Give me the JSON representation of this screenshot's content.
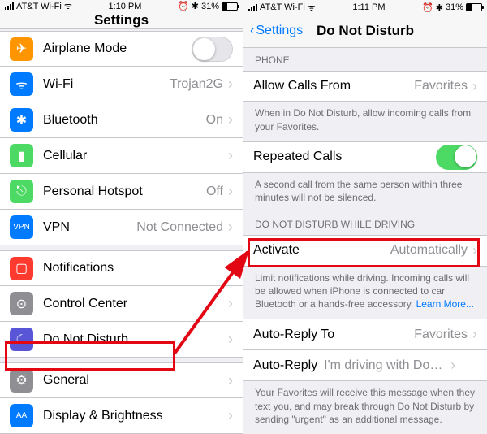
{
  "left": {
    "status": {
      "carrier": "AT&T Wi-Fi",
      "time": "1:10 PM",
      "battery": "31%",
      "alarm": "⏰",
      "bt": "✱"
    },
    "title": "Settings",
    "rows": [
      {
        "icon": "✈",
        "color": "#ff9500",
        "label": "Airplane Mode",
        "toggle": "off"
      },
      {
        "icon": "ᯤ",
        "color": "#007aff",
        "label": "Wi-Fi",
        "value": "Trojan2G"
      },
      {
        "icon": "✱",
        "color": "#007aff",
        "label": "Bluetooth",
        "value": "On"
      },
      {
        "icon": "▮",
        "color": "#4cd964",
        "label": "Cellular",
        "value": ""
      },
      {
        "icon": "⎋",
        "color": "#4cd964",
        "label": "Personal Hotspot",
        "value": "Off"
      },
      {
        "icon": "VPN",
        "color": "#007aff",
        "label": "VPN",
        "value": "Not Connected",
        "small": true
      }
    ],
    "rows2": [
      {
        "icon": "▢",
        "color": "#ff3b30",
        "label": "Notifications"
      },
      {
        "icon": "⊙",
        "color": "#8e8e93",
        "label": "Control Center"
      },
      {
        "icon": "☾",
        "color": "#5856d6",
        "label": "Do Not Disturb"
      }
    ],
    "rows3": [
      {
        "icon": "⚙",
        "color": "#8e8e93",
        "label": "General"
      },
      {
        "icon": "AA",
        "color": "#007aff",
        "label": "Display & Brightness",
        "small": true
      }
    ]
  },
  "right": {
    "status": {
      "carrier": "AT&T Wi-Fi",
      "time": "1:11 PM",
      "battery": "31%",
      "alarm": "⏰",
      "bt": "✱"
    },
    "back": "Settings",
    "title": "Do Not Disturb",
    "sec_phone": "PHONE",
    "allow_label": "Allow Calls From",
    "allow_value": "Favorites",
    "allow_footer": "When in Do Not Disturb, allow incoming calls from your Favorites.",
    "repeated_label": "Repeated Calls",
    "repeated_footer": "A second call from the same person within three minutes will not be silenced.",
    "sec_driving": "DO NOT DISTURB WHILE DRIVING",
    "activate_label": "Activate",
    "activate_value": "Automatically",
    "activate_footer": "Limit notifications while driving. Incoming calls will be allowed when iPhone is connected to car Bluetooth or a hands-free accessory. ",
    "learn_more": "Learn More...",
    "autoreply_to_label": "Auto-Reply To",
    "autoreply_to_value": "Favorites",
    "autoreply_label": "Auto-Reply",
    "autoreply_value": "I'm driving with Do Not Distu...",
    "autoreply_footer": "Your Favorites will receive this message when they text you, and may break through Do Not Disturb by sending \"urgent\" as an additional message."
  }
}
